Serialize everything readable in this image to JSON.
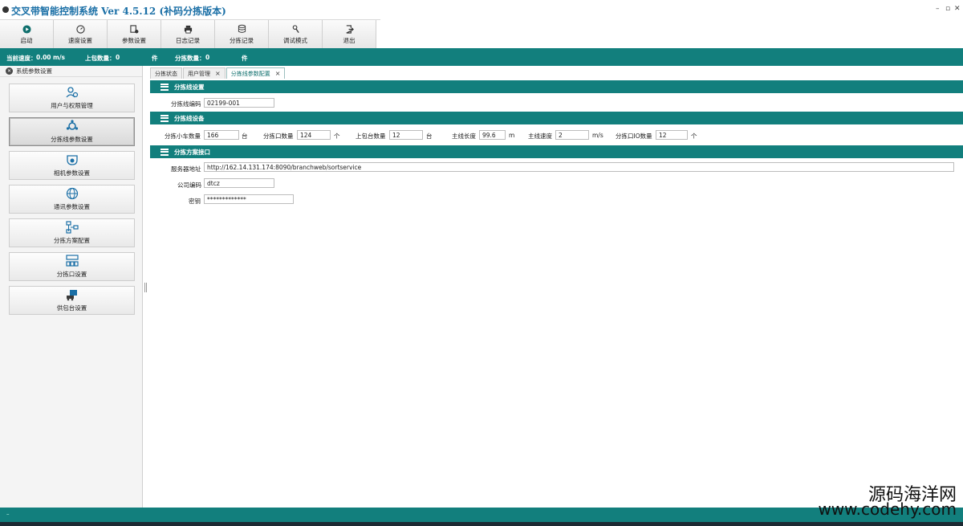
{
  "window": {
    "title": "交叉带智能控制系统 Ver 4.5.12 (补码分拣版本)",
    "minimize": "–",
    "restore": "▫",
    "close": "✕"
  },
  "toolbar": {
    "buttons": [
      {
        "label": "启动",
        "icon": "play-icon"
      },
      {
        "label": "速度设置",
        "icon": "speed-icon"
      },
      {
        "label": "参数设置",
        "icon": "params-icon"
      },
      {
        "label": "日志记录",
        "icon": "printer-icon"
      },
      {
        "label": "分拣记录",
        "icon": "database-icon"
      },
      {
        "label": "调试模式",
        "icon": "debug-icon"
      },
      {
        "label": "退出",
        "icon": "exit-icon"
      }
    ]
  },
  "statusbar": {
    "speed_label": "当前速度：",
    "speed_value": "0.00",
    "speed_unit": "m/s",
    "upload_label": "上包数量：",
    "upload_value": "0",
    "upload_unit": "件",
    "sort_label": "分拣数量：",
    "sort_value": "0",
    "sort_unit": "件"
  },
  "left_panel": {
    "header": "系统参数设置",
    "items": [
      {
        "label": "用户与权限管理",
        "icon": "users-icon"
      },
      {
        "label": "分拣线参数设置",
        "icon": "network-icon"
      },
      {
        "label": "相机参数设置",
        "icon": "camera-icon"
      },
      {
        "label": "通讯参数设置",
        "icon": "globe-icon"
      },
      {
        "label": "分拣方案配置",
        "icon": "flow-icon"
      },
      {
        "label": "分拣口设置",
        "icon": "grid-icon"
      },
      {
        "label": "供包台设置",
        "icon": "package-icon"
      }
    ]
  },
  "tabs": [
    {
      "label": "分拣状态",
      "closable": false
    },
    {
      "label": "用户管理",
      "closable": true
    },
    {
      "label": "分拣线参数配置",
      "closable": true,
      "active": true
    }
  ],
  "sections": {
    "line_settings": {
      "title": "分拣线设置",
      "code_label": "分拣线编码",
      "code_value": "02199-001"
    },
    "line_devices": {
      "title": "分拣线设备",
      "carts_label": "分拣小车数量",
      "carts_value": "166",
      "carts_unit": "台",
      "ports_label": "分拣口数量",
      "ports_value": "124",
      "ports_unit": "个",
      "stations_label": "上包台数量",
      "stations_value": "12",
      "stations_unit": "台",
      "length_label": "主线长度",
      "length_value": "99.6",
      "length_unit": "m",
      "speed_label": "主线速度",
      "speed_value": "2",
      "speed_unit": "m/s",
      "io_label": "分拣口IO数量",
      "io_value": "12",
      "io_unit": "个"
    },
    "plan_interface": {
      "title": "分拣方案接口",
      "server_label": "服务器地址",
      "server_value": "http://162.14.131.174:8090/branchweb/sortservice",
      "company_label": "公司编码",
      "company_value": "dtcz",
      "secret_label": "密钥",
      "secret_value": "*************"
    }
  },
  "watermark": {
    "line1": "源码海洋网",
    "line2": "www.codehy.com"
  }
}
